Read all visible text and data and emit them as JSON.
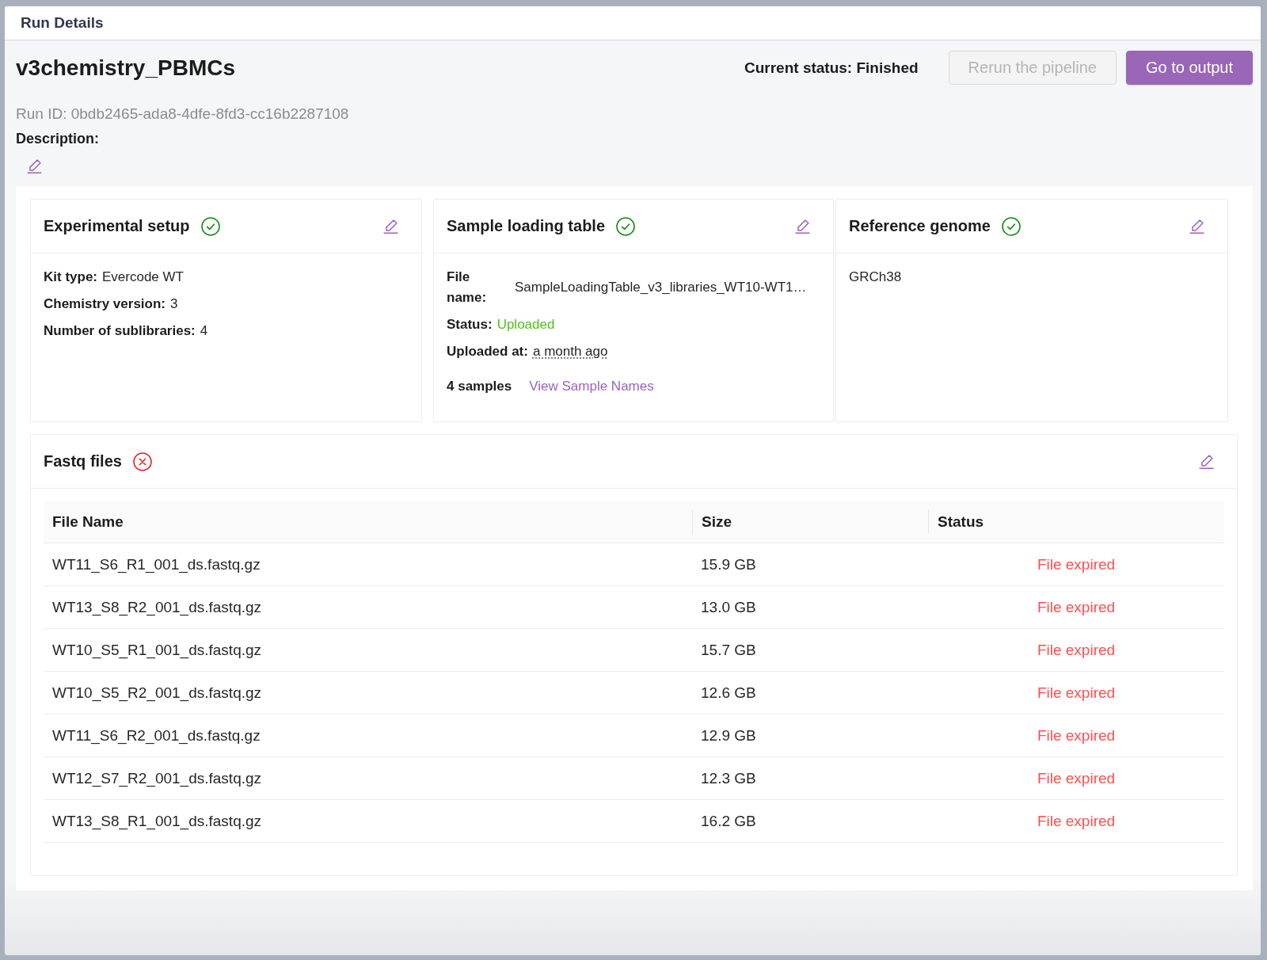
{
  "window": {
    "title": "Run Details"
  },
  "run": {
    "name": "v3chemistry_PBMCs",
    "status": "Current status: Finished",
    "run_id": "Run ID: 0bdb2465-ada8-4dfe-8fd3-cc16b2287108",
    "description_label": "Description:"
  },
  "actions": [
    {
      "label": "Rerun the pipeline",
      "kind": "secondary",
      "disabled": true
    },
    {
      "label": "Go to output",
      "kind": "primary",
      "disabled": false
    }
  ],
  "cards": [
    {
      "title": "Experimental setup",
      "complete": true,
      "fields": [
        {
          "label": "Kit type:",
          "value": "Evercode WT",
          "kind": "plain"
        },
        {
          "label": "Chemistry version:",
          "value": "3",
          "kind": "plain"
        },
        {
          "label": "Number of sublibraries:",
          "value": "4",
          "kind": "plain"
        }
      ]
    },
    {
      "title": "Sample loading table",
      "complete": true,
      "fields": [
        {
          "label": "File name:",
          "value": "SampleLoadingTable_v3_libraries_WT10-WT1…",
          "kind": "file"
        },
        {
          "label": "Status:",
          "value": "Uploaded",
          "kind": "success"
        },
        {
          "label": "Uploaded at:",
          "value": "a month ago",
          "kind": "time"
        }
      ],
      "samples": {
        "count": "4 samples",
        "link": "View Sample Names"
      }
    },
    {
      "title": "Reference genome",
      "complete": true,
      "text": "GRCh38"
    }
  ],
  "fastq": {
    "title": "Fastq files",
    "complete": false,
    "table": {
      "columns": [
        "File Name",
        "Size",
        "Status"
      ],
      "rows": [
        {
          "file_name": "WT11_S6_R1_001_ds.fastq.gz",
          "size": "15.9 GB",
          "status": "File expired"
        },
        {
          "file_name": "WT13_S8_R2_001_ds.fastq.gz",
          "size": "13.0 GB",
          "status": "File expired"
        },
        {
          "file_name": "WT10_S5_R1_001_ds.fastq.gz",
          "size": "15.7 GB",
          "status": "File expired"
        },
        {
          "file_name": "WT10_S5_R2_001_ds.fastq.gz",
          "size": "12.6 GB",
          "status": "File expired"
        },
        {
          "file_name": "WT11_S6_R2_001_ds.fastq.gz",
          "size": "12.9 GB",
          "status": "File expired"
        },
        {
          "file_name": "WT12_S7_R2_001_ds.fastq.gz",
          "size": "12.3 GB",
          "status": "File expired"
        },
        {
          "file_name": "WT13_S8_R1_001_ds.fastq.gz",
          "size": "16.2 GB",
          "status": "File expired"
        }
      ]
    }
  }
}
